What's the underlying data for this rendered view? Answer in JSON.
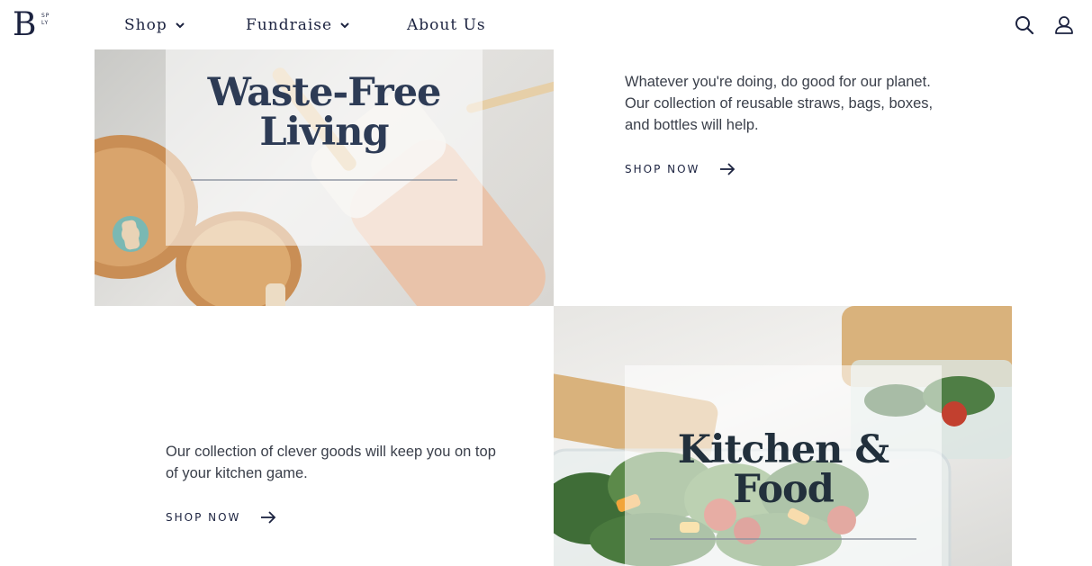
{
  "brand": {
    "logo_letter": "B",
    "logo_small_top": "SP",
    "logo_small_bottom": "LY"
  },
  "nav": {
    "items": [
      {
        "label": "Shop",
        "has_dropdown": true
      },
      {
        "label": "Fundraise",
        "has_dropdown": true
      },
      {
        "label": "About Us",
        "has_dropdown": false
      }
    ],
    "icons": [
      "search-icon",
      "user-icon"
    ]
  },
  "sections": {
    "waste_free": {
      "title_line1": "Waste-Free",
      "title_line2": "Living",
      "description": "Whatever you're doing, do good for our planet. Our collection of reusable straws, bags, boxes, and bottles will help.",
      "cta": "SHOP NOW"
    },
    "kitchen": {
      "title_line1": "Kitchen &",
      "title_line2": "Food",
      "description": "Our collection of clever goods will keep you on top of your kitchen game.",
      "cta": "SHOP NOW"
    }
  },
  "colors": {
    "navy": "#1c2340",
    "body_text": "#3a3f4a",
    "overlay_title": "#2d3b55"
  }
}
